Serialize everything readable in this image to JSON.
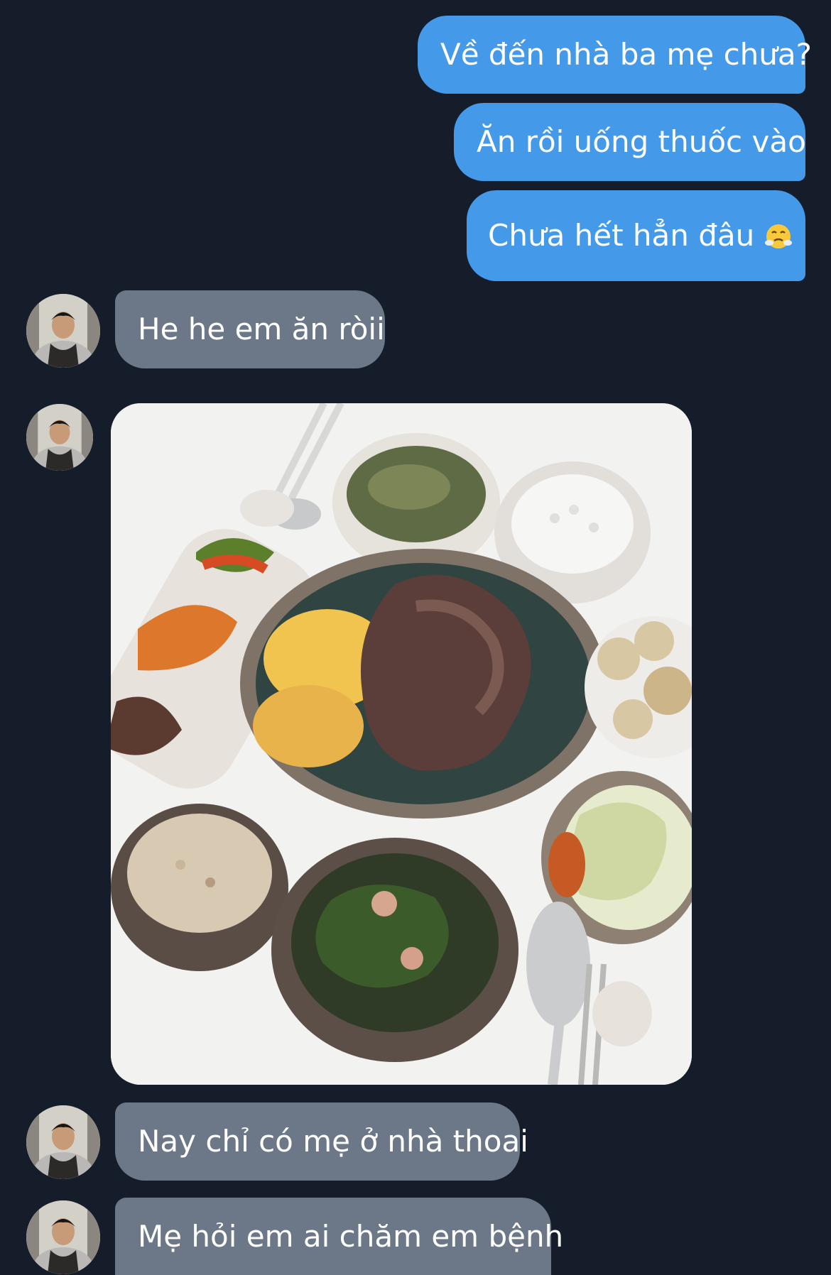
{
  "colors": {
    "background": "#151d2a",
    "outgoing_bubble": "#4499e9",
    "incoming_bubble": "#6c7888"
  },
  "messages": {
    "out_1": "Về đến nhà ba mẹ chưa?",
    "out_2": "Ăn rồi uống thuốc vào",
    "out_3": "Chưa hết hẳn đâu",
    "in_1": "He he em ăn ròii",
    "in_2": "Nay chỉ có mẹ ở nhà thoai",
    "in_3": "Mẹ hỏi em ai chăm em bệnh"
  },
  "emoji": "face-with-steam-emoji",
  "image": "meal-photo"
}
